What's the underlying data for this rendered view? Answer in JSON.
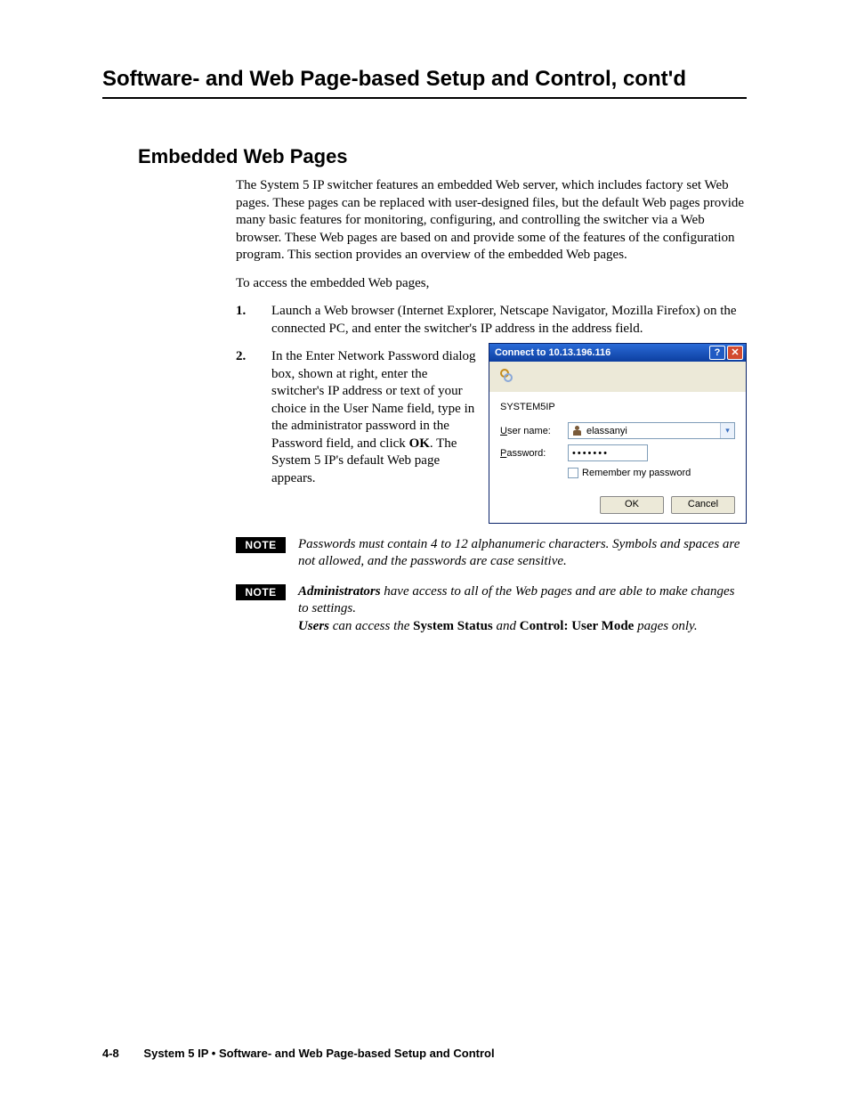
{
  "chapter_title": "Software- and Web Page-based Setup and Control, cont'd",
  "section_title": "Embedded Web Pages",
  "intro_para": "The System 5 IP switcher features an embedded Web server, which includes factory set Web pages.  These pages can be replaced with user-designed files, but the default Web pages provide many basic features for monitoring, configuring, and controlling the switcher via a Web browser.  These Web pages are based on and provide some of the features of the configuration program.  This section provides an overview of the embedded Web pages.",
  "access_line": "To access the embedded Web pages,",
  "steps": {
    "s1_num": "1.",
    "s1_text": "Launch a Web browser (Internet Explorer, Netscape Navigator, Mozilla Firefox) on the connected PC, and enter the switcher's IP address in the address field.",
    "s2_num": "2.",
    "s2_text_a": "In the Enter Network Password dialog box, shown at right, enter the switcher's IP address or text of your choice in the User Name field, type in the administrator password in the Password field, and click ",
    "s2_ok": "OK",
    "s2_text_b": ".  The System 5 IP's default Web page appears."
  },
  "dialog": {
    "title": "Connect to 10.13.196.116",
    "realm": "SYSTEM5IP",
    "user_label": "User name:",
    "user_underline_char": "U",
    "user_value": "elassanyi",
    "pass_label": "Password:",
    "pass_underline_char": "P",
    "pass_mask": "•••••••",
    "remember_label": "Remember my password",
    "remember_underline_char": "R",
    "ok": "OK",
    "cancel": "Cancel",
    "help_symbol": "?",
    "close_symbol": "✕",
    "dropdown_symbol": "▾"
  },
  "notes": {
    "label": "NOTE",
    "n1": "Passwords must contain 4 to 12 alphanumeric characters.  Symbols and spaces are not allowed, and the passwords are case sensitive.",
    "n2_a": "Administrators",
    "n2_b": " have access to all of the Web pages and are able to make changes to settings.",
    "n2_c": "Users",
    "n2_d": " can access the ",
    "n2_e": "System Status",
    "n2_f": " and ",
    "n2_g": "Control: User Mode",
    "n2_h": " pages only."
  },
  "footer": {
    "page_num": "4-8",
    "text": "System 5 IP • Software- and Web Page-based Setup and Control"
  }
}
